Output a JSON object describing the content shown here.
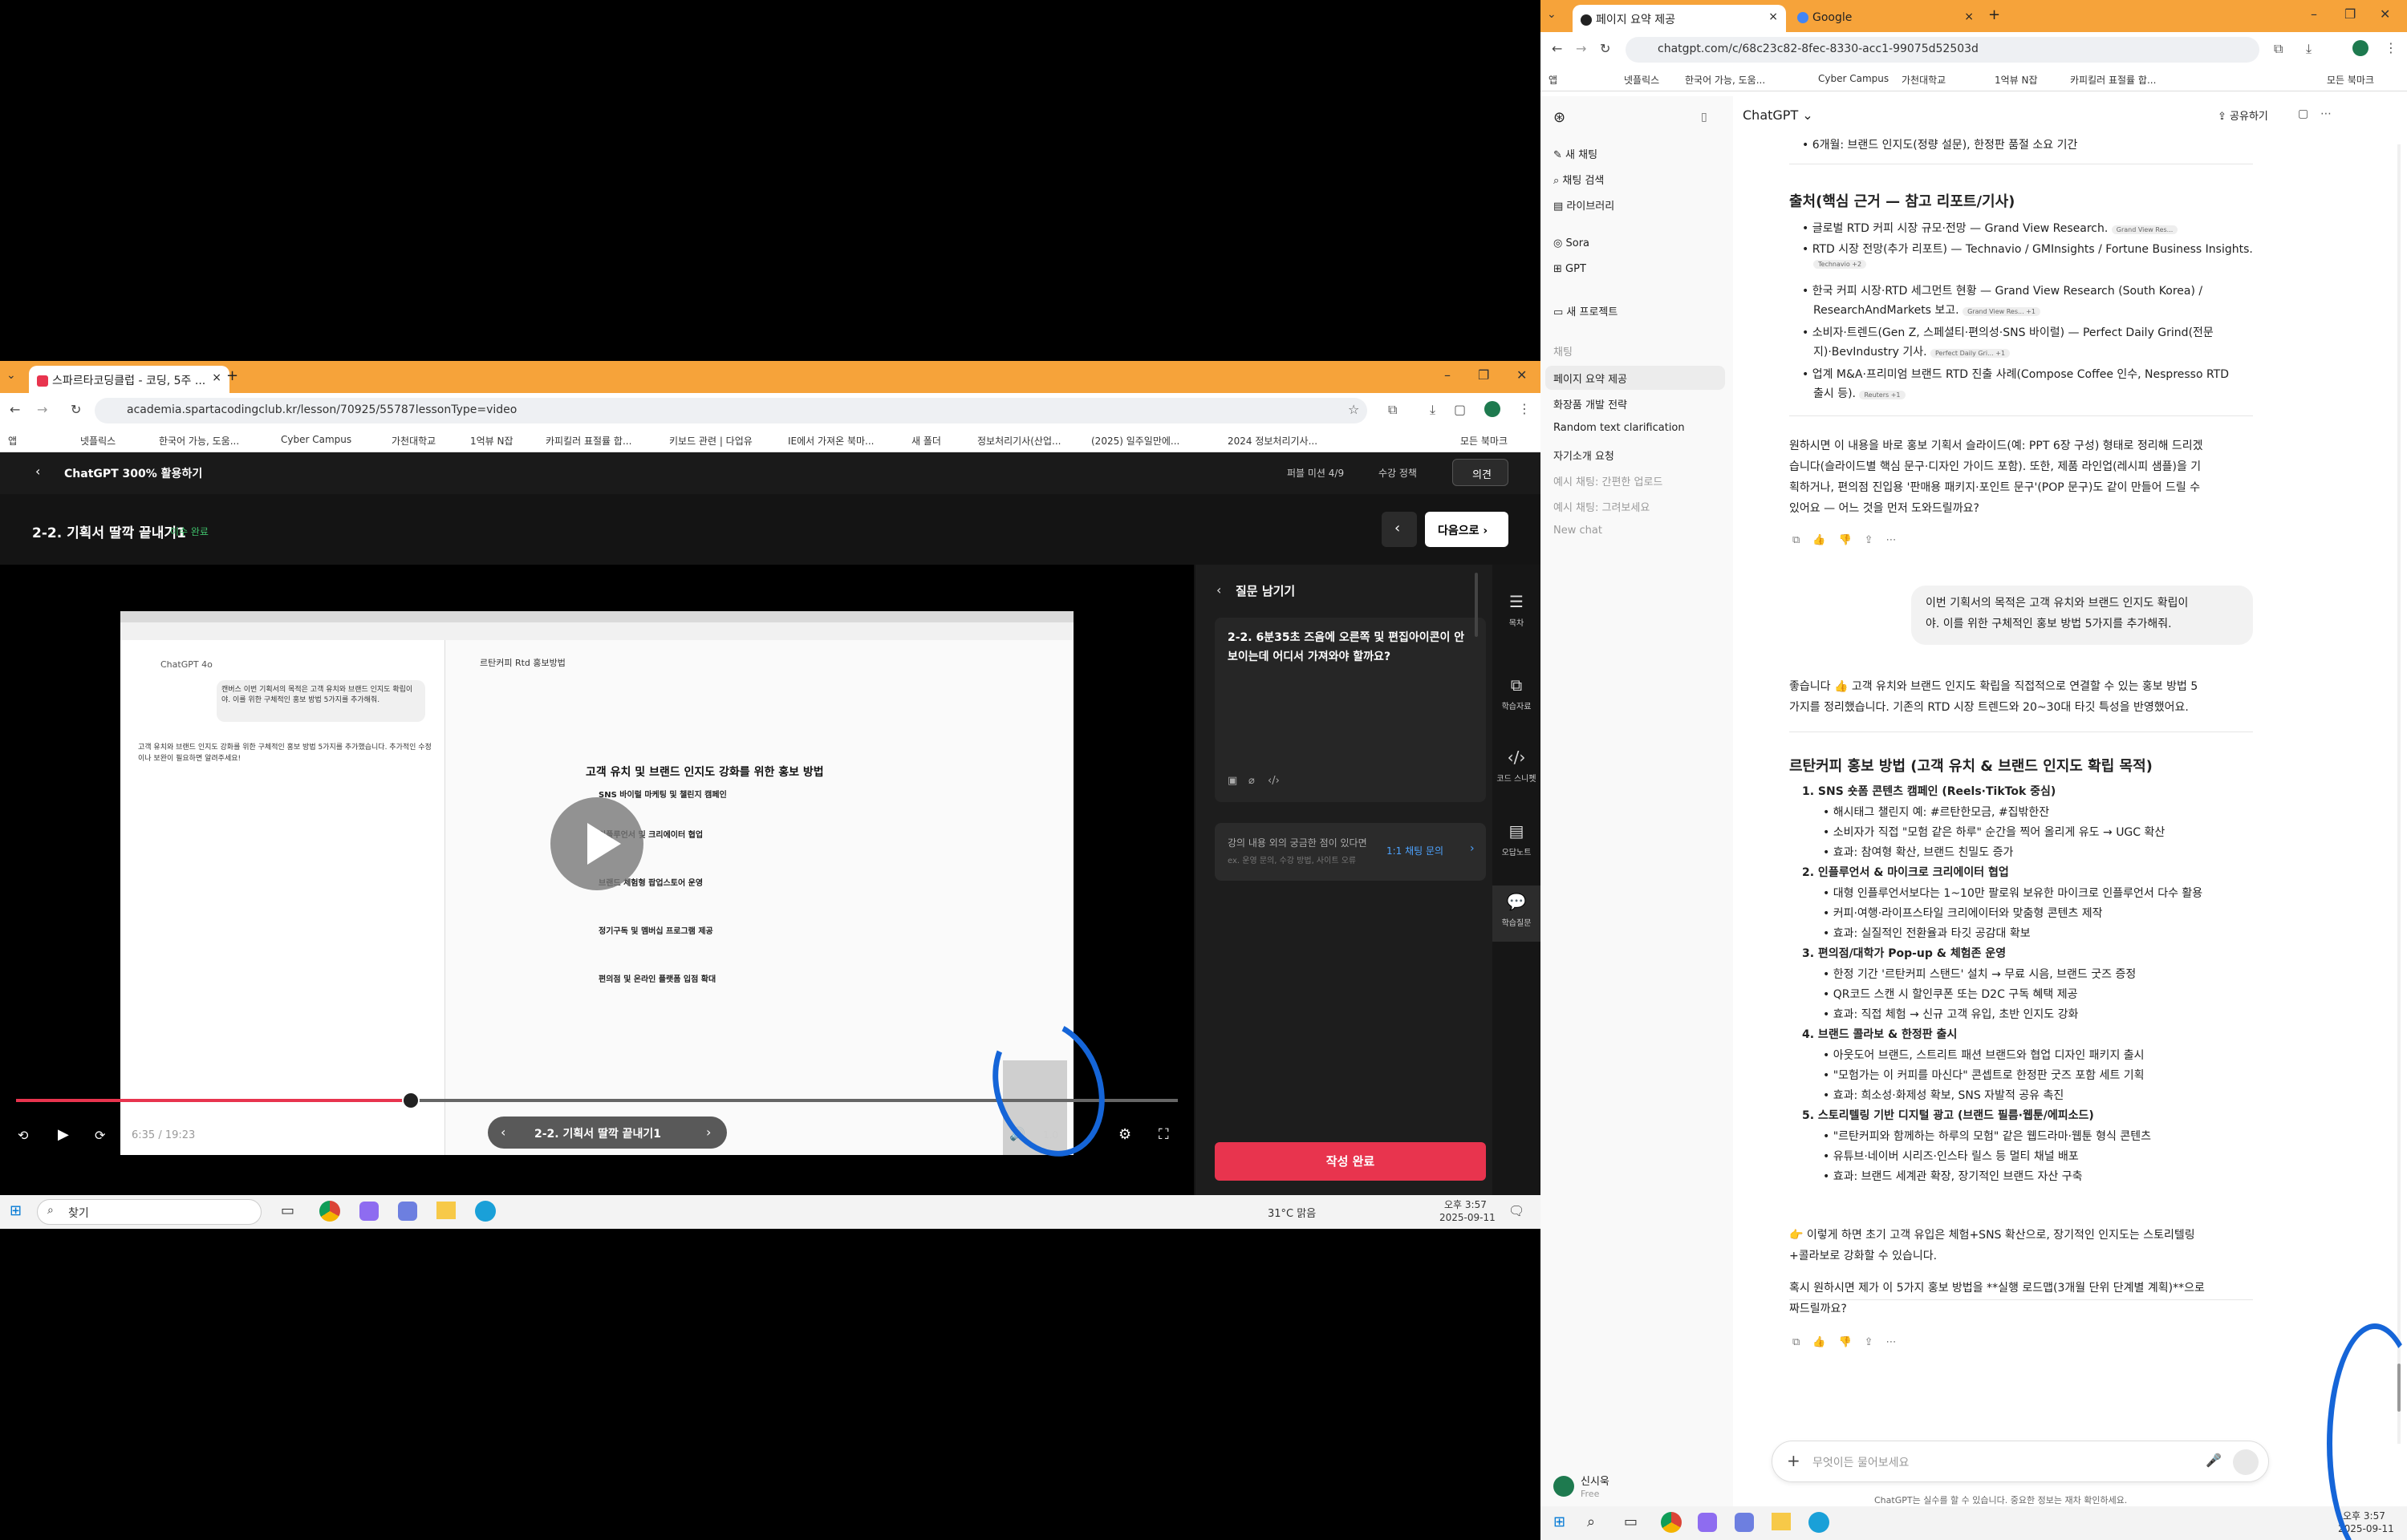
{
  "left_browser": {
    "tabs": [
      {
        "label": "스파르타코딩클럽 - 코딩, 5주 ..."
      }
    ],
    "url": "academia.spartacodingclub.kr/lesson/70925/55787lessonType=video",
    "bookmarks": [
      "앱",
      "넷플릭스",
      "한국어 가능, 도움...",
      "Cyber Campus",
      "가천대학교",
      "1억뷰 N잡",
      "카피킬러 표절률 합...",
      "키보드 관련 | 다업유",
      "IE에서 가져온 북마...",
      "새 폴더",
      "정보처리기사(산업...",
      "(2025) 일주일만에...",
      "2024 정보처리기사...",
      "모든 북마크"
    ]
  },
  "course": {
    "back_label": "ChatGPT 300% 활용하기",
    "mission": "퍼블 미션 4/9",
    "policy": "수강 정책",
    "opinion": "의견",
    "lesson_title": "2-2. 기획서 딸깍 끝내기1",
    "lesson_status": "이수 완료",
    "next_label": "다음으로",
    "video_time": "6:35 / 19:23",
    "chapter_label": "2-2. 기획서 딸깍 끝내기1",
    "speed": "1.0",
    "panel_title": "질문 남기기",
    "question_text": "2-2. 6분35초 즈음에 오른쪽 및 편집아이콘이 안 보이는데 어디서 가져와야 할까요?",
    "hint_main": "강의 내용 외의 궁금한 점이 있다면",
    "hint_sub": "ex. 운영 문의, 수강 방법, 사이트 오류",
    "hint_link": "1:1 채팅 문의",
    "submit_label": "작성 완료",
    "rail": [
      "목차",
      "학습자료",
      "코드 스니펫",
      "오답노트",
      "학습질문"
    ]
  },
  "video_frame": {
    "left_heading": "ChatGPT 4o",
    "bubble": "캔버스 이번 기획서의 목적은 고객 유치와 브랜드 인지도 확립이야. 이를 위한 구체적인 홍보 방법 5가지를 추가해줘.",
    "doc_title": "르탄커피 Rtd 홍보방법",
    "left_answer": "고객 유치와 브랜드 인지도 강화를 위한 구체적인 홍보 방법 5가지를 추가했습니다. 추가적인 수정이나 보완이 필요하면 알려주세요!",
    "heading": "고객 유치 및 브랜드 인지도 강화를 위한 홍보 방법",
    "items": [
      "SNS 바이럴 마케팅 및 챌린지 캠페인",
      "인플루언서 및 크리에이터 협업",
      "브랜드 체험형 팝업스토어 운영",
      "정기구독 및 멤버십 프로그램 제공",
      "편의점 및 온라인 플랫폼 입점 확대"
    ]
  },
  "taskbar_left": {
    "search": "찾기",
    "weather": "31°C 맑음",
    "time": "오후 3:57",
    "date": "2025-09-11"
  },
  "right_browser": {
    "tabs": [
      {
        "label": "페이지 요약 제공"
      },
      {
        "label": "Google"
      }
    ],
    "url": "chatgpt.com/c/68c23c82-8fec-8330-acc1-99075d52503d",
    "bookmarks": [
      "앱",
      "넷플릭스",
      "한국어 가능, 도움...",
      "Cyber Campus",
      "가천대학교",
      "1억뷰 N잡",
      "카피킬러 표절률 합...",
      "모든 북마크"
    ]
  },
  "chatgpt": {
    "model": "ChatGPT",
    "share": "공유하기",
    "sidebar": {
      "items": [
        "새 채팅",
        "채팅 검색",
        "라이브러리",
        "Sora",
        "GPT",
        "새 프로젝트"
      ],
      "section": "채팅",
      "chats": [
        "페이지 요약 제공",
        "화장품 개발 전략",
        "Random text clarification",
        "자기소개 요청",
        "예시 채팅: 간편한 업로드",
        "예시 채팅: 그려보세요",
        "New chat"
      ],
      "user": "신시욱",
      "plan": "Free"
    },
    "top_line": "6개월: 브랜드 인지도(정량 설문), 한정판 품절 소요 기간",
    "sources_heading": "출처(핵심 근거 — 참고 리포트/기사)",
    "sources": [
      "글로벌 RTD 커피 시장 규모·전망 — Grand View Research.",
      "RTD 시장 전망(추가 리포트) — Technavio / GMInsights / Fortune Business Insights.",
      "한국 커피 시장·RTD 세그먼트 현황 — Grand View Research (South Korea) /",
      "ResearchAndMarkets 보고.",
      "소비자·트렌드(Gen Z, 스페셜티·편의성·SNS 바이럴) — Perfect Daily Grind(전문",
      "지)·BevIndustry 기사.",
      "업계 M&A·프리미엄 브랜드 RTD 진출 사례(Compose Coffee 인수, Nespresso RTD",
      "출시 등)."
    ],
    "source_tags": [
      "Grand View Res...",
      "Technavio +2",
      "Grand View Res... +1",
      "Perfect Daily Gri... +1",
      "Reuters +1"
    ],
    "para1": [
      "원하시면 이 내용을 바로 홍보 기획서 슬라이드(예: PPT 6장 구성) 형태로 정리해 드리겠",
      "습니다(슬라이드별 핵심 문구·디자인 가이드 포함). 또한, 제품 라인업(레시피 샘플)을 기",
      "획하거나, 편의점 진입용 '판매용 패키지·포인트 문구'(POP 문구)도 같이 만들어 드릴 수",
      "있어요 — 어느 것을 먼저 도와드릴까요?"
    ],
    "user_msg": [
      "이번 기획서의 목적은 고객 유치와 브랜드 인지도 확립이",
      "야. 이를 위한 구체적인 홍보 방법 5가지를 추가해줘."
    ],
    "intro": [
      "좋습니다 👍 고객 유치와 브랜드 인지도 확립을 직접적으로 연결할 수 있는 홍보 방법 5",
      "가지를 정리했습니다. 기존의 RTD 시장 트렌드와 20~30대 타깃 특성을 반영했어요."
    ],
    "plan_heading": "르탄커피 홍보 방법 (고객 유치 & 브랜드 인지도 확립 목적)",
    "methods": [
      {
        "title": "1. SNS 숏폼 콘텐츠 캠페인 (Reels·TikTok 중심)",
        "bullets": [
          "해시태그 챌린지 예: #르탄한모금, #집밖한잔",
          "소비자가 직접 \"모험 같은 하루\" 순간을 찍어 올리게 유도 → UGC 확산",
          "효과: 참여형 확산, 브랜드 친밀도 증가"
        ]
      },
      {
        "title": "2. 인플루언서 & 마이크로 크리에이터 협업",
        "bullets": [
          "대형 인플루언서보다는 1~10만 팔로워 보유한 마이크로 인플루언서 다수 활용",
          "커피·여행·라이프스타일 크리에이터와 맞춤형 콘텐츠 제작",
          "효과: 실질적인 전환율과 타깃 공감대 확보"
        ]
      },
      {
        "title": "3. 편의점/대학가 Pop-up & 체험존 운영",
        "bullets": [
          "한정 기간 '르탄커피 스탠드' 설치 → 무료 시음, 브랜드 굿즈 증정",
          "QR코드 스캔 시 할인쿠폰 또는 D2C 구독 혜택 제공",
          "효과: 직접 체험 → 신규 고객 유입, 초반 인지도 강화"
        ]
      },
      {
        "title": "4. 브랜드 콜라보 & 한정판 출시",
        "bullets": [
          "아웃도어 브랜드, 스트리트 패션 브랜드와 협업 디자인 패키지 출시",
          "\"모험가는 이 커피를 마신다\" 콘셉트로 한정판 굿즈 포함 세트 기획",
          "효과: 희소성·화제성 확보, SNS 자발적 공유 촉진"
        ]
      },
      {
        "title": "5. 스토리텔링 기반 디지털 광고 (브랜드 필름·웹툰/에피소드)",
        "bullets": [
          "\"르탄커피와 함께하는 하루의 모험\" 같은 웹드라마·웹툰 형식 콘텐츠",
          "유튜브·네이버 시리즈·인스타 릴스 등 멀티 채널 배포",
          "효과: 브랜드 세계관 확장, 장기적인 브랜드 자산 구축"
        ]
      }
    ],
    "closing1": [
      "👉 이렇게 하면 초기 고객 유입은 체험+SNS 확산으로, 장기적인 인지도는 스토리텔링",
      "+콜라보로 강화할 수 있습니다."
    ],
    "closing2": [
      "혹시 원하시면 제가 이 5가지 홍보 방법을 **실행 로드맵(3개월 단위 단계별 계획)**으로",
      "짜드릴까요?"
    ],
    "input_placeholder": "무엇이든 물어보세요",
    "disclaimer": "ChatGPT는 실수를 할 수 있습니다. 중요한 정보는 재차 확인하세요."
  },
  "taskbar_right": {
    "time": "오후 3:57",
    "date": "2025-09-11"
  },
  "colors": {
    "accent_orange": "#f6a33a",
    "submit_red": "#e8344e",
    "annotation_blue": "#1565d8"
  }
}
